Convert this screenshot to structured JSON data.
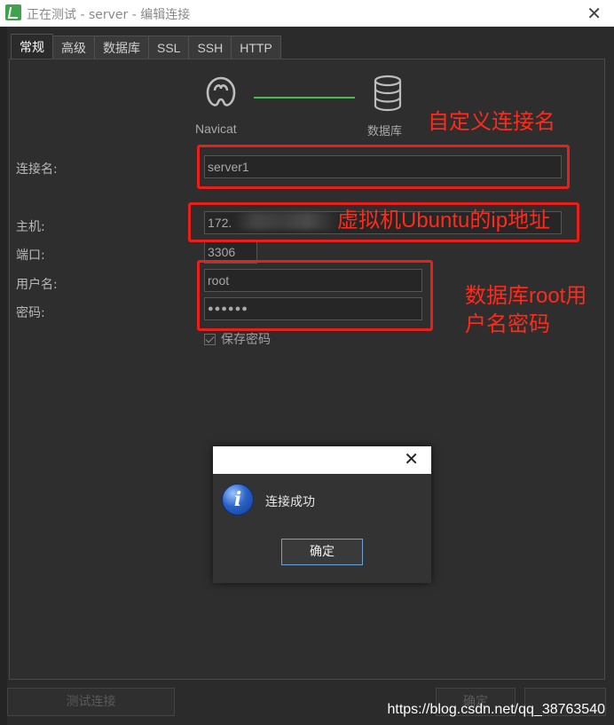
{
  "window": {
    "title": "正在测试 - server - 编辑连接",
    "close_glyph": "✕"
  },
  "tabs": [
    {
      "label": "常规",
      "active": true
    },
    {
      "label": "高级",
      "active": false
    },
    {
      "label": "数据库",
      "active": false
    },
    {
      "label": "SSL",
      "active": false
    },
    {
      "label": "SSH",
      "active": false
    },
    {
      "label": "HTTP",
      "active": false
    }
  ],
  "flow": {
    "left_label": "Navicat",
    "right_label": "数据库",
    "line_color": "#3fbf4f"
  },
  "form": {
    "connection_name": {
      "label": "连接名:",
      "value": "server1"
    },
    "host": {
      "label": "主机:",
      "value": "172."
    },
    "port": {
      "label": "端口:",
      "value": "3306"
    },
    "username": {
      "label": "用户名:",
      "value": "root"
    },
    "password": {
      "label": "密码:",
      "value": "●●●●●●"
    },
    "save_password": {
      "label": "保存密码",
      "checked": true
    }
  },
  "annotations": {
    "connection_name": "自定义连接名",
    "host": "虚拟机Ubuntu的ip地址",
    "credentials_line1": "数据库root用",
    "credentials_line2": "户名密码",
    "color": "#e8201c"
  },
  "buttons": {
    "test_connection": "测试连接",
    "ok": "确定"
  },
  "message_box": {
    "text": "连接成功",
    "ok_label": "确定",
    "icon": "info-icon",
    "close_glyph": "✕"
  },
  "watermark": "https://blog.csdn.net/qq_38763540"
}
